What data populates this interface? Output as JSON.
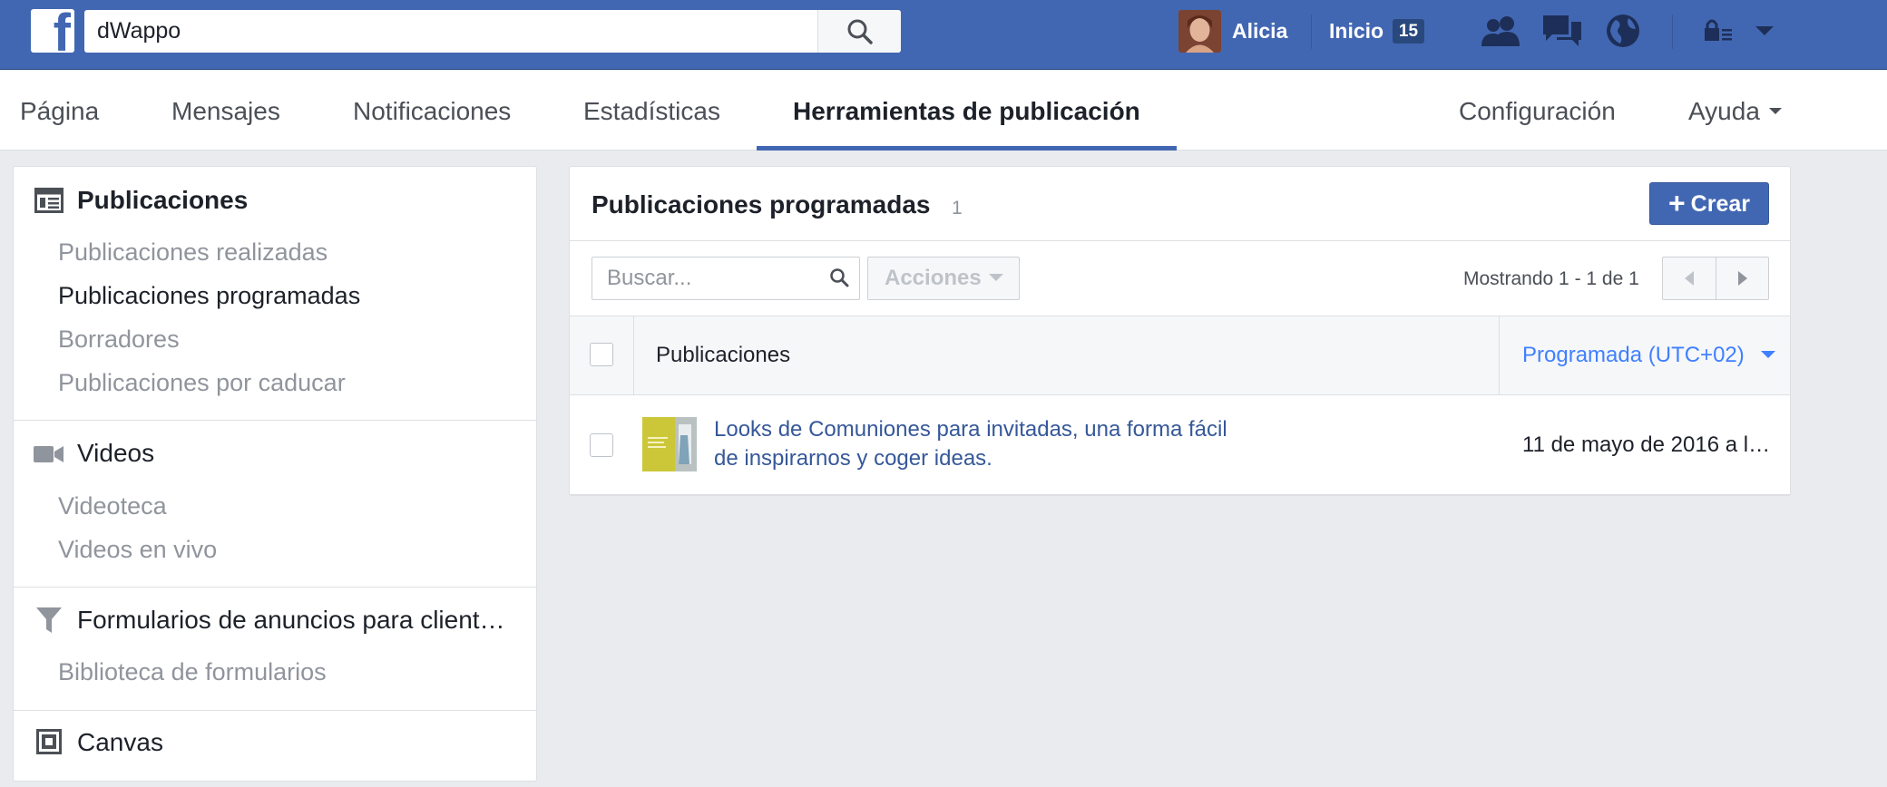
{
  "topbar": {
    "logo_letter": "f",
    "search_value": "dWappo",
    "user_name": "Alicia",
    "home_label": "Inicio",
    "home_count": "15",
    "bg_color": "#4267b2",
    "icons": [
      "friends-icon",
      "messages-icon",
      "globe-icon",
      "privacy-lock-icon",
      "account-menu-icon"
    ]
  },
  "page_nav": {
    "tabs": [
      {
        "label": "Página"
      },
      {
        "label": "Mensajes"
      },
      {
        "label": "Notificaciones"
      },
      {
        "label": "Estadísticas"
      },
      {
        "label": "Herramientas de publicación",
        "active": true
      },
      {
        "label": "Configuración"
      },
      {
        "label": "Ayuda"
      }
    ]
  },
  "sidebar": {
    "publicaciones": {
      "title": "Publicaciones",
      "items": [
        "Publicaciones realizadas",
        "Publicaciones programadas",
        "Borradores",
        "Publicaciones por caducar"
      ],
      "active_index": 1
    },
    "videos": {
      "title": "Videos",
      "items": [
        "Videoteca",
        "Videos en vivo"
      ]
    },
    "formularios": {
      "title": "Formularios de anuncios para client…",
      "items": [
        "Biblioteca de formularios"
      ]
    },
    "canvas": {
      "title": "Canvas"
    }
  },
  "main": {
    "title": "Publicaciones programadas",
    "count": "1",
    "create_label": "Crear",
    "search_placeholder": "Buscar...",
    "actions_label": "Acciones",
    "showing_text": "Mostrando 1 - 1 de 1",
    "table": {
      "columns": [
        "Publicaciones",
        "Programada (UTC+02)"
      ],
      "rows": [
        {
          "title_line1": "Looks de Comuniones para invitadas, una forma fácil",
          "title_line2": "de inspirarnos y coger ideas.",
          "scheduled": "11 de mayo de 2016 a l…"
        }
      ]
    }
  },
  "colors": {
    "accent": "#4267b2",
    "link": "#365899",
    "sort_header": "#4080ff",
    "page_bg": "#e9ebee"
  }
}
